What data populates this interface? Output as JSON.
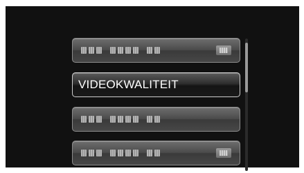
{
  "menu": {
    "selected_index": 1,
    "items": [
      {
        "label": "",
        "obscured": true,
        "has_value_icon": true
      },
      {
        "label": "VIDEOKWALITEIT",
        "obscured": false,
        "has_value_icon": false
      },
      {
        "label": "",
        "obscured": true,
        "has_value_icon": false
      },
      {
        "label": "",
        "obscured": true,
        "has_value_icon": true
      }
    ]
  },
  "colors": {
    "screen_background": "#111111",
    "item_background": "#4b4b4b",
    "selected_item_background": "#1a1a1a",
    "text": "#ffffff",
    "scroll_thumb": "#9a9a9a"
  },
  "icons": {
    "value_indicator": "value-setting-icon"
  }
}
